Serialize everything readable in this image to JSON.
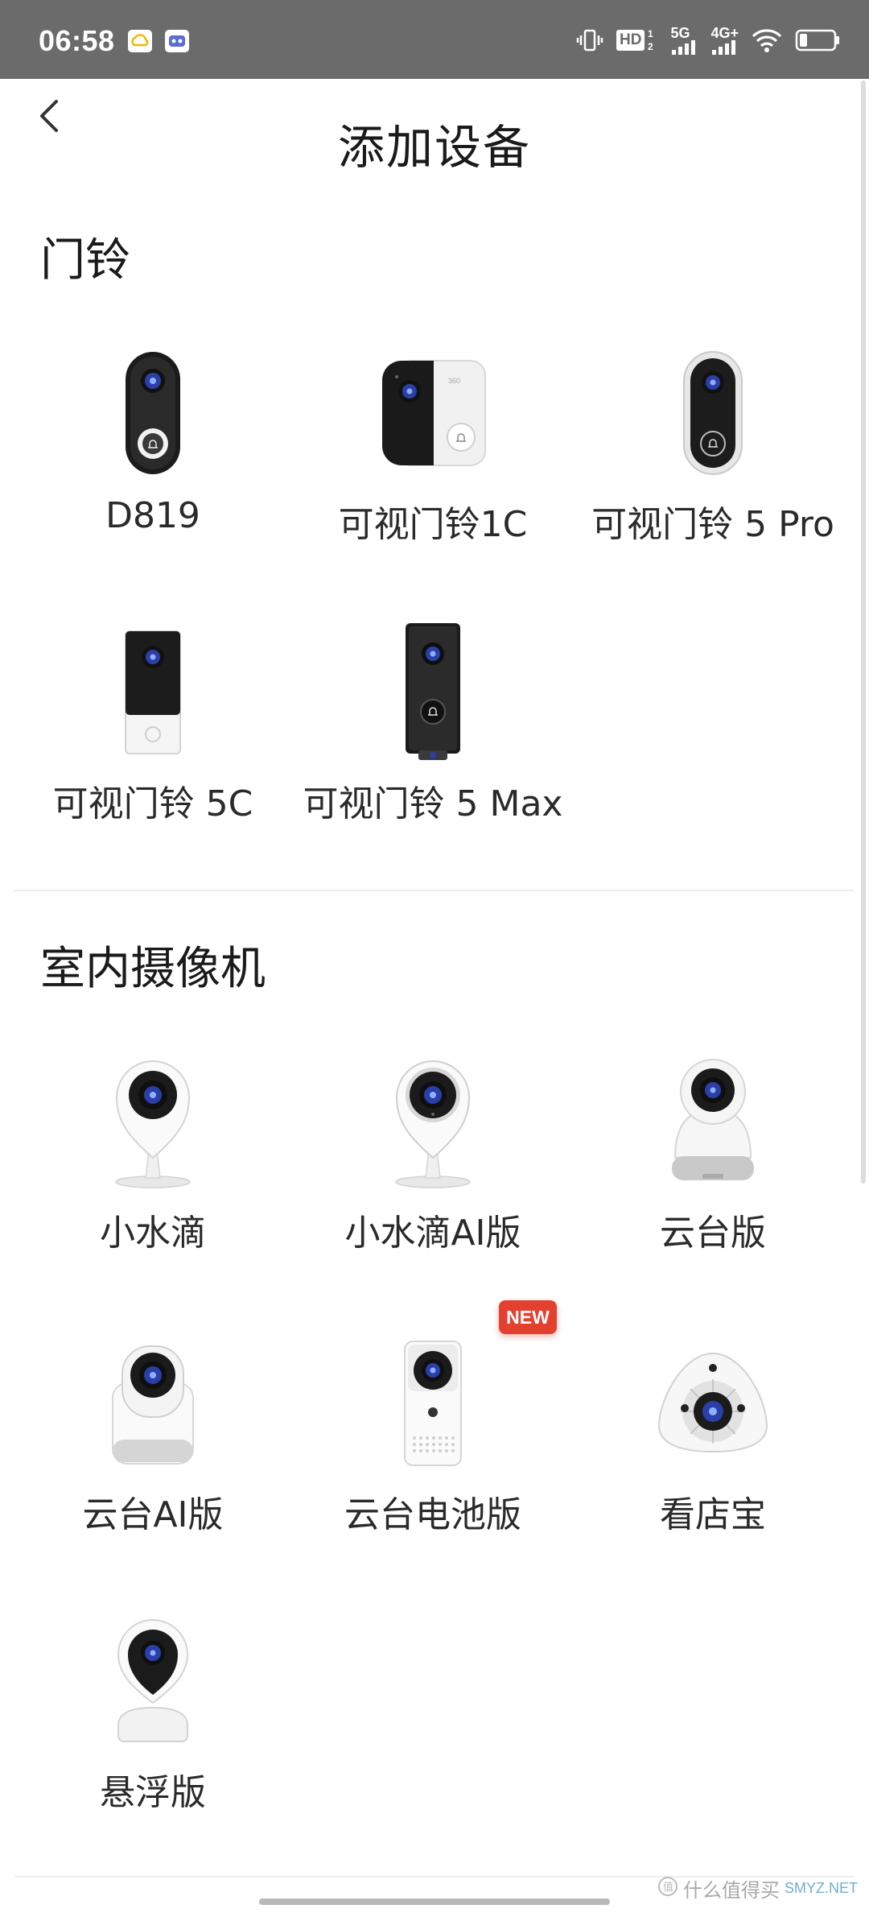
{
  "status_bar": {
    "time": "06:58",
    "hd_label": "HD",
    "signal_5g_label": "5G",
    "signal_4g_label": "4G+"
  },
  "header": {
    "title": "添加设备"
  },
  "sections": [
    {
      "title": "门铃",
      "devices": [
        {
          "label": "D819"
        },
        {
          "label": "可视门铃1C"
        },
        {
          "label": "可视门铃 5 Pro"
        },
        {
          "label": "可视门铃 5C"
        },
        {
          "label": "可视门铃 5 Max"
        }
      ]
    },
    {
      "title": "室内摄像机",
      "devices": [
        {
          "label": "小水滴"
        },
        {
          "label": "小水滴AI版"
        },
        {
          "label": "云台版"
        },
        {
          "label": "云台AI版"
        },
        {
          "label": "云台电池版",
          "badge": "NEW"
        },
        {
          "label": "看店宝"
        },
        {
          "label": "悬浮版"
        }
      ]
    }
  ],
  "watermark": {
    "text": "什么值得买",
    "site": "SMYZ.NET"
  },
  "colors": {
    "status_bar_bg": "#6b6b6b",
    "badge_red": "#e4402f",
    "lens_blue": "#2b3fa8"
  }
}
